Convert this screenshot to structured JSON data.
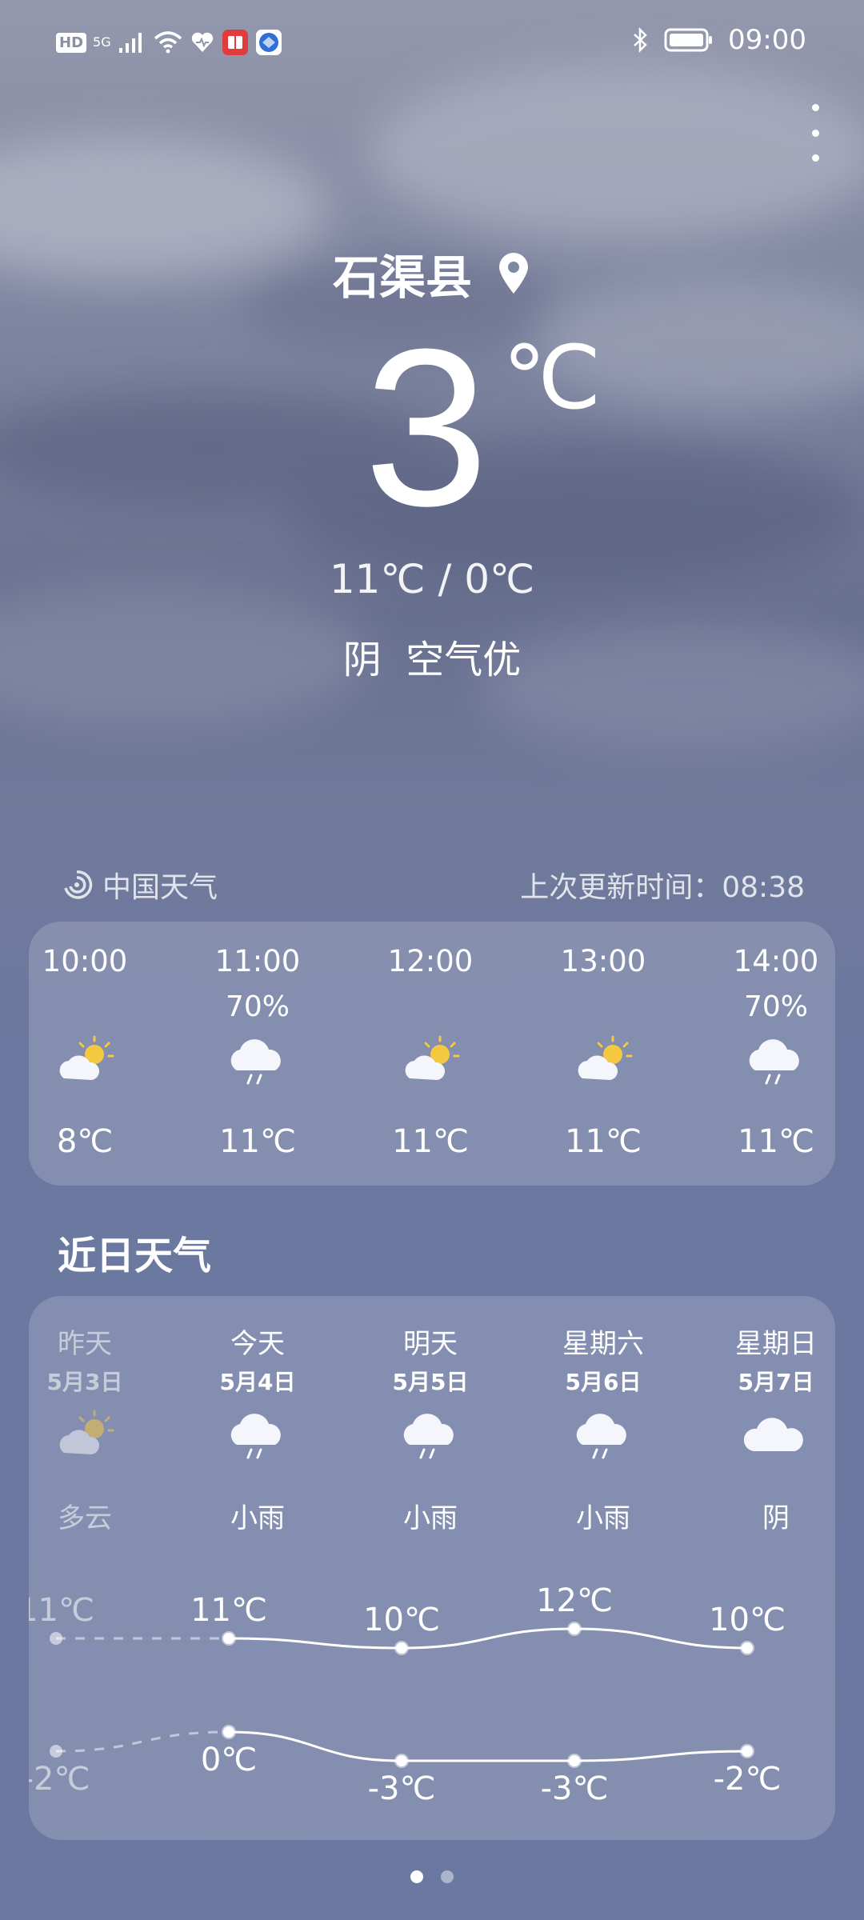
{
  "status_bar": {
    "left_icons": [
      "HD",
      "5G",
      "signal-icon",
      "wifi-icon",
      "heart-icon",
      "red-app-icon",
      "blue-app-icon"
    ],
    "hd": "HD",
    "net": "5G",
    "time": "09:00",
    "right_icons": [
      "bluetooth-icon",
      "battery-icon"
    ]
  },
  "location": {
    "city": "石渠县",
    "icon": "location-pin-icon"
  },
  "current": {
    "temp": "3",
    "unit": "℃",
    "high_low": "11℃ / 0℃",
    "condition": "阴",
    "air_quality": "空气优"
  },
  "source": {
    "name": "中国天气",
    "icon": "china-weather-logo-icon"
  },
  "update": {
    "label": "上次更新时间：",
    "time": "08:38"
  },
  "hourly": [
    {
      "time": "10:00",
      "precip": "",
      "icon": "partly-sunny-icon",
      "temp": "8℃"
    },
    {
      "time": "11:00",
      "precip": "70%",
      "icon": "rain-icon",
      "temp": "11℃"
    },
    {
      "time": "12:00",
      "precip": "",
      "icon": "partly-sunny-icon",
      "temp": "11℃"
    },
    {
      "time": "13:00",
      "precip": "",
      "icon": "partly-sunny-icon",
      "temp": "11℃"
    },
    {
      "time": "14:00",
      "precip": "70%",
      "icon": "rain-icon",
      "temp": "11℃"
    }
  ],
  "daily_title": "近日天气",
  "daily": [
    {
      "name": "昨天",
      "date": "5月3日",
      "icon": "partly-sunny-icon",
      "condition": "多云",
      "high": "11℃",
      "low": "-2℃",
      "high_val": 11,
      "low_val": -2
    },
    {
      "name": "今天",
      "date": "5月4日",
      "icon": "rain-icon",
      "condition": "小雨",
      "high": "11℃",
      "low": "0℃",
      "high_val": 11,
      "low_val": 0
    },
    {
      "name": "明天",
      "date": "5月5日",
      "icon": "rain-icon",
      "condition": "小雨",
      "high": "10℃",
      "low": "-3℃",
      "high_val": 10,
      "low_val": -3
    },
    {
      "name": "星期六",
      "date": "5月6日",
      "icon": "rain-icon",
      "condition": "小雨",
      "high": "12℃",
      "low": "-3℃",
      "high_val": 12,
      "low_val": -3
    },
    {
      "name": "星期日",
      "date": "5月7日",
      "icon": "cloudy-icon",
      "condition": "阴",
      "high": "10℃",
      "low": "-2℃",
      "high_val": 10,
      "low_val": -2
    }
  ],
  "pager": {
    "pages": 2,
    "current": 1
  }
}
